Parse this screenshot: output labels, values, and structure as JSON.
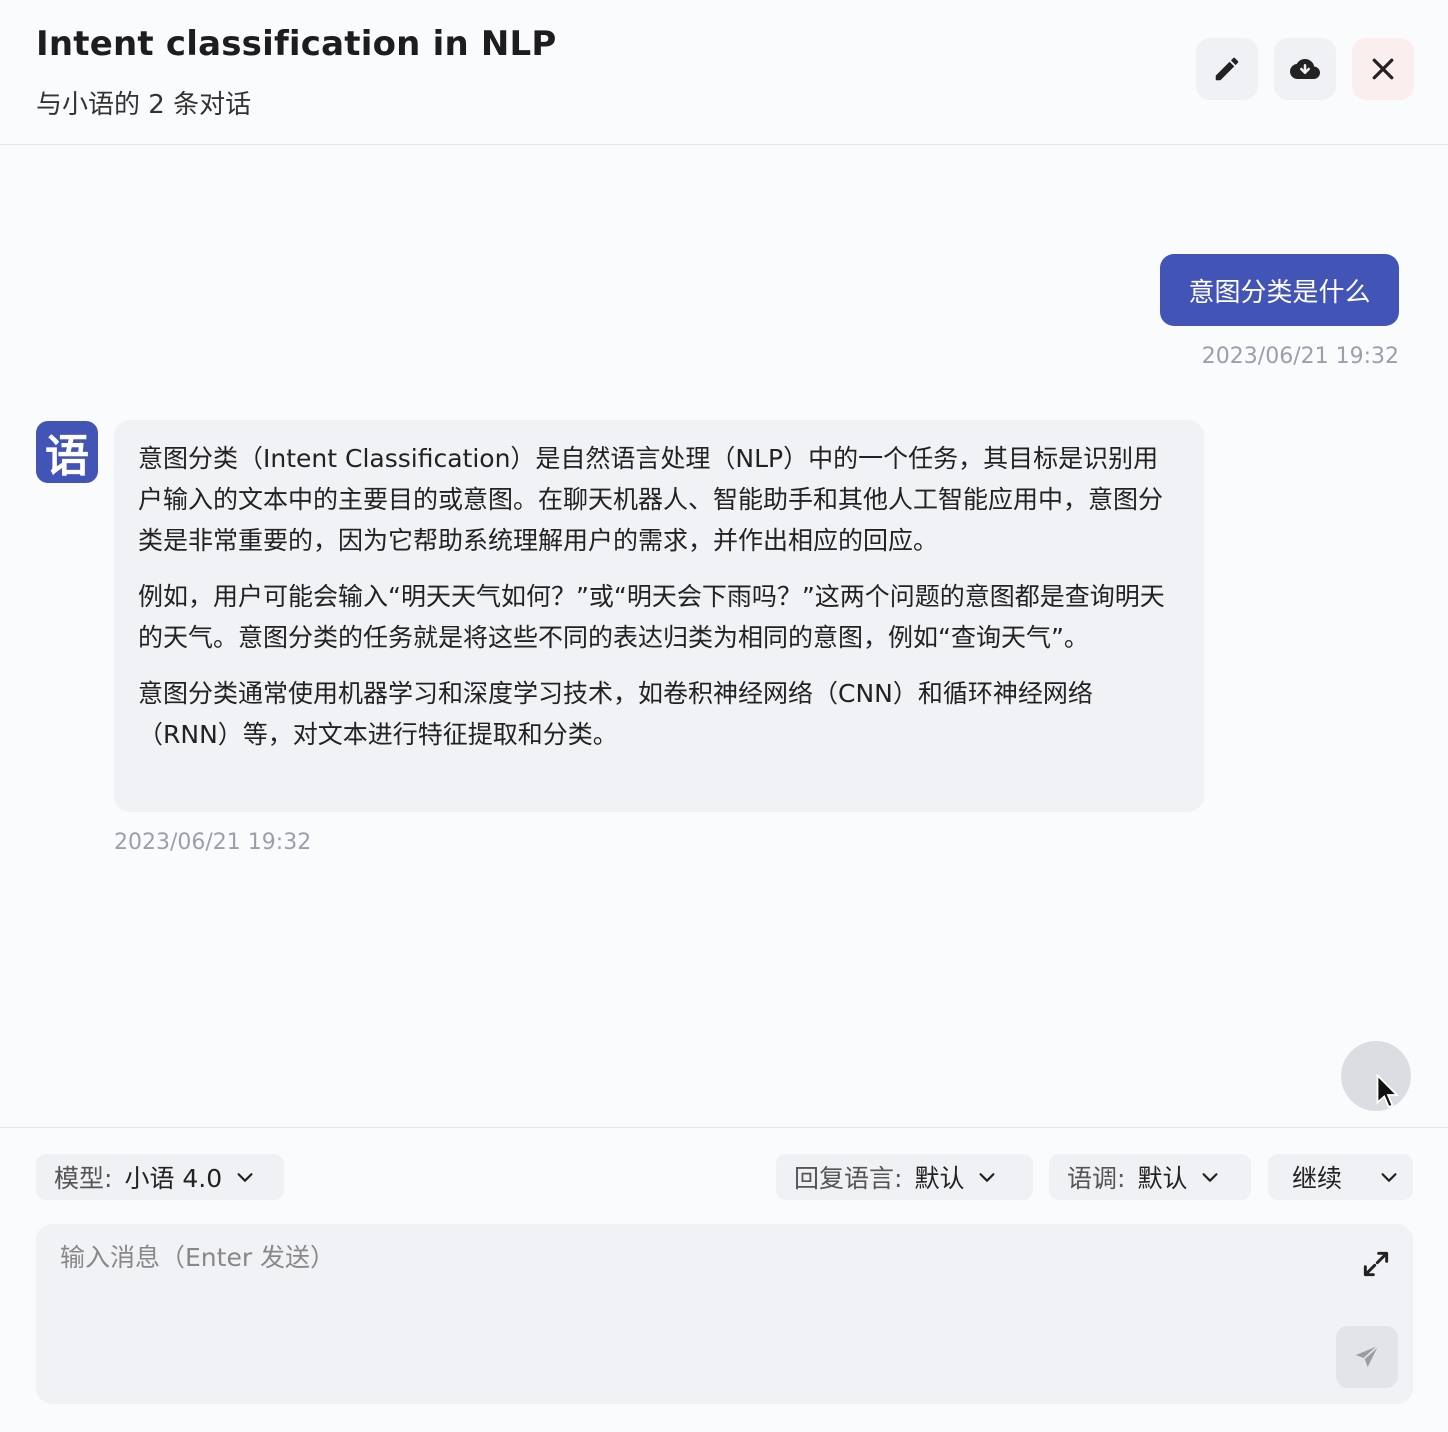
{
  "header": {
    "title": "Intent classification in NLP",
    "subtitle": "与小语的 2 条对话",
    "buttons": [
      {
        "icon": "pencil-icon"
      },
      {
        "icon": "cloud-download-icon"
      },
      {
        "icon": "close-icon"
      }
    ]
  },
  "messages": [
    {
      "role": "user",
      "text": "意图分类是什么",
      "timestamp": "2023/06/21 19:32"
    },
    {
      "role": "assistant",
      "avatar_glyph": "语",
      "paragraphs": [
        "意图分类（Intent Classification）是自然语言处理（NLP）中的一个任务，其目标是识别用户输入的文本中的主要目的或意图。在聊天机器人、智能助手和其他人工智能应用中，意图分类是非常重要的，因为它帮助系统理解用户的需求，并作出相应的回应。",
        "例如，用户可能会输入“明天天气如何？”或“明天会下雨吗？”这两个问题的意图都是查询明天的天气。意图分类的任务就是将这些不同的表达归类为相同的意图，例如“查询天气”。",
        "意图分类通常使用机器学习和深度学习技术，如卷积神经网络（CNN）和循环神经网络（RNN）等，对文本进行特征提取和分类。"
      ],
      "timestamp": "2023/06/21 19:32"
    }
  ],
  "toolbar": {
    "model_label": "模型:",
    "model_value": "小语 4.0",
    "lang_label": "回复语言:",
    "lang_value": "默认",
    "tone_label": "语调:",
    "tone_value": "默认",
    "continue_label": "继续"
  },
  "input": {
    "placeholder": "输入消息（Enter 发送）",
    "value": ""
  },
  "colors": {
    "accent": "#4254b6",
    "bubble_bg": "#f1f2f5",
    "page_bg": "#fafbfd",
    "close_bg": "#fbeeee"
  }
}
